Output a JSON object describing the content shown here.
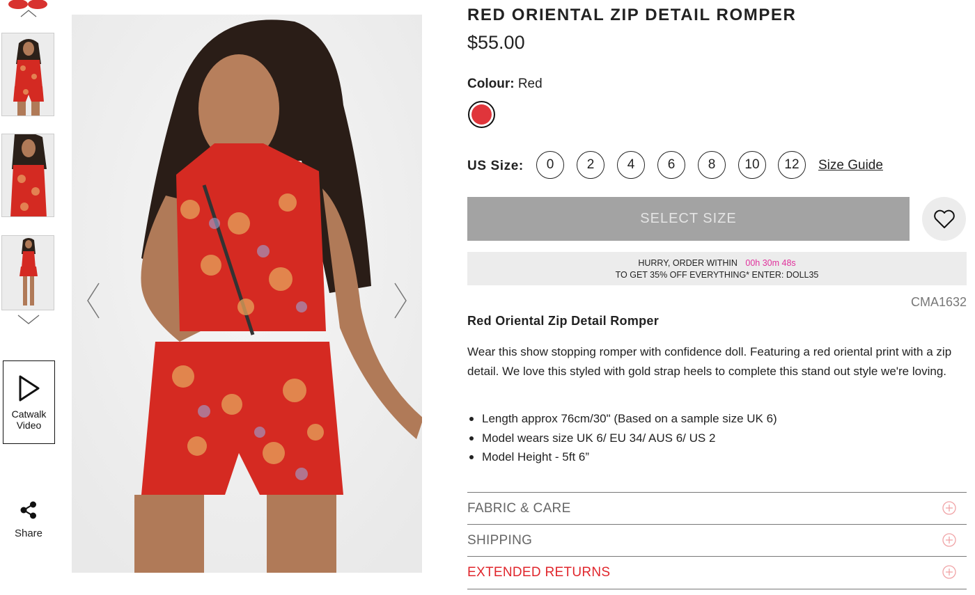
{
  "gallery": {
    "thumbnails": [
      "thumb-top-cropped",
      "thumb-front",
      "thumb-front-close",
      "thumb-full-body"
    ],
    "video_label_line1": "Catwalk",
    "video_label_line2": "Video",
    "share_label": "Share"
  },
  "product": {
    "title": "RED ORIENTAL ZIP DETAIL ROMPER",
    "price": "$55.00",
    "colour_label": "Colour:",
    "colour_value": "Red",
    "swatch_color": "#e0353b",
    "size_label": "US Size:",
    "sizes": [
      "0",
      "2",
      "4",
      "6",
      "8",
      "10",
      "12"
    ],
    "size_guide_label": "Size Guide",
    "select_size_label": "SELECT SIZE",
    "promo_line1": "HURRY, ORDER WITHIN",
    "promo_timer": "00h 30m 48s",
    "promo_line2": "TO GET 35% OFF EVERYTHING* ENTER: DOLL35",
    "sku": "CMA1632",
    "name": "Red Oriental Zip Detail Romper",
    "description": "Wear this show stopping romper with confidence doll. Featuring a red oriental print with a zip detail. We love this styled with gold strap heels to complete this stand out style we're loving.",
    "bullets": [
      "Length approx 76cm/30\" (Based on a sample size UK 6)",
      "Model wears size UK 6/ EU 34/ AUS 6/ US 2",
      "Model Height - 5ft 6”"
    ]
  },
  "accordions": [
    {
      "label": "FABRIC & CARE",
      "highlight": false
    },
    {
      "label": "SHIPPING",
      "highlight": false
    },
    {
      "label": "EXTENDED RETURNS",
      "highlight": true
    }
  ],
  "colors": {
    "accent_red": "#e0262c",
    "timer_pink": "#e0319c",
    "button_grey": "#a3a3a3"
  }
}
